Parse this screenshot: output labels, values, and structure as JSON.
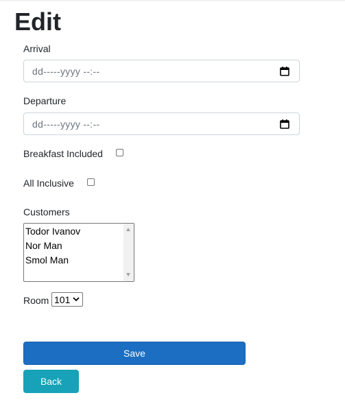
{
  "page": {
    "title": "Edit"
  },
  "form": {
    "arrival": {
      "label": "Arrival",
      "placeholder": "dd-----yyyy --:--",
      "icon": "calendar-icon"
    },
    "departure": {
      "label": "Departure",
      "placeholder": "dd-----yyyy --:--",
      "icon": "calendar-icon"
    },
    "breakfast_included": {
      "label": "Breakfast Included",
      "checked": false
    },
    "all_inclusive": {
      "label": "All Inclusive",
      "checked": false
    },
    "customers": {
      "label": "Customers",
      "options": [
        "Todor Ivanov",
        "Nor Man",
        "Smol Man"
      ]
    },
    "room": {
      "label": "Room",
      "selected": "101"
    },
    "buttons": {
      "save_label": "Save",
      "back_label": "Back"
    }
  },
  "colors": {
    "save_button": "#1b6ec2",
    "back_button": "#17a2b8",
    "text": "#212529"
  }
}
